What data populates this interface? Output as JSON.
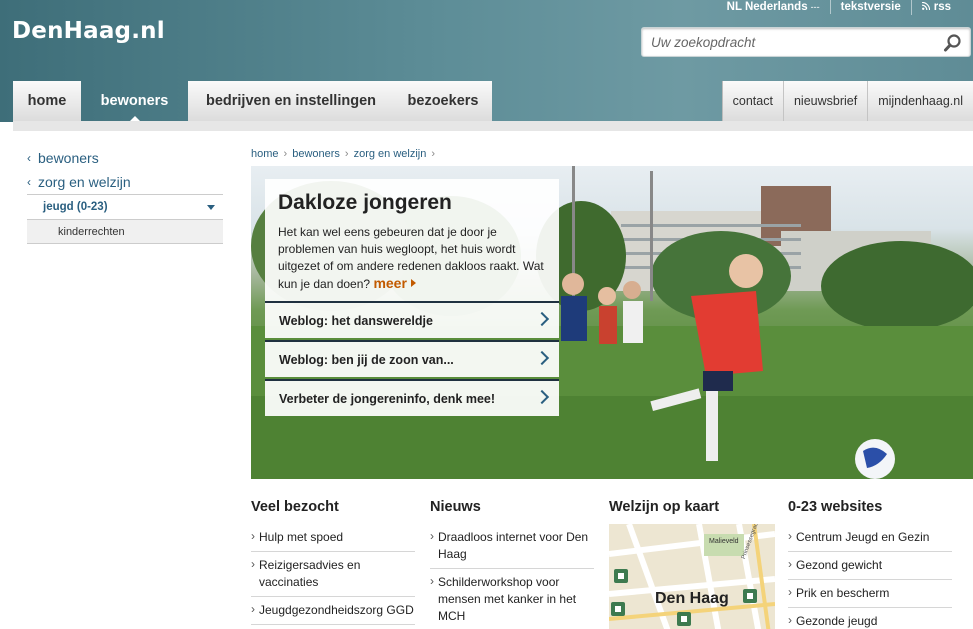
{
  "header": {
    "logo": "DenHaag.nl",
    "lang_label": "NL Nederlands",
    "lang_marker": "---",
    "textversion": "tekstversie",
    "rss": "rss",
    "search_placeholder": "Uw zoekopdracht"
  },
  "nav": {
    "tabs": [
      {
        "label": "home"
      },
      {
        "label": "bewoners"
      },
      {
        "label": "bedrijven en instellingen"
      },
      {
        "label": "bezoekers"
      }
    ],
    "right": [
      {
        "label": "contact"
      },
      {
        "label": "nieuwsbrief"
      },
      {
        "label": "mijndenhaag.nl"
      }
    ]
  },
  "sidebar": {
    "items": [
      {
        "label": "bewoners"
      },
      {
        "label": "zorg en welzijn"
      }
    ],
    "active": "jeugd (0-23)",
    "sub": "kinderrechten"
  },
  "breadcrumb": [
    "home",
    "bewoners",
    "zorg en welzijn"
  ],
  "breadcrumb_sep": "›",
  "hero": {
    "title": "Dakloze jongeren",
    "text": "Het kan wel eens gebeuren dat je door je problemen van huis wegloopt, het huis wordt uitgezet of om andere redenen dakloos raakt. Wat kun je dan doen?",
    "more": "meer",
    "links": [
      {
        "label": "Weblog: het danswereldje"
      },
      {
        "label": "Weblog: ben jij de zoon van..."
      },
      {
        "label": "Verbeter de jongereninfo, denk mee!"
      }
    ]
  },
  "columns": {
    "veel_bezocht": {
      "title": "Veel bezocht",
      "items": [
        "Hulp met spoed",
        "Reizigersadvies en vaccinaties",
        "Jeugdgezondheidszorg GGD"
      ]
    },
    "nieuws": {
      "title": "Nieuws",
      "items": [
        "Draadloos internet voor Den Haag",
        "Schilderworkshop voor mensen met kanker in het MCH"
      ]
    },
    "kaart": {
      "title": "Welzijn op kaart",
      "map_label": "Den Haag",
      "map_place": "Malieveld",
      "map_street": "Prinsessegracht"
    },
    "websites": {
      "title": "0-23 websites",
      "items": [
        "Centrum Jeugd en Gezin",
        "Gezond gewicht",
        "Prik en bescherm",
        "Gezonde jeugd"
      ]
    }
  },
  "colors": {
    "header": "#5d8d97",
    "link": "#2a5f80",
    "more": "#c25a00"
  }
}
